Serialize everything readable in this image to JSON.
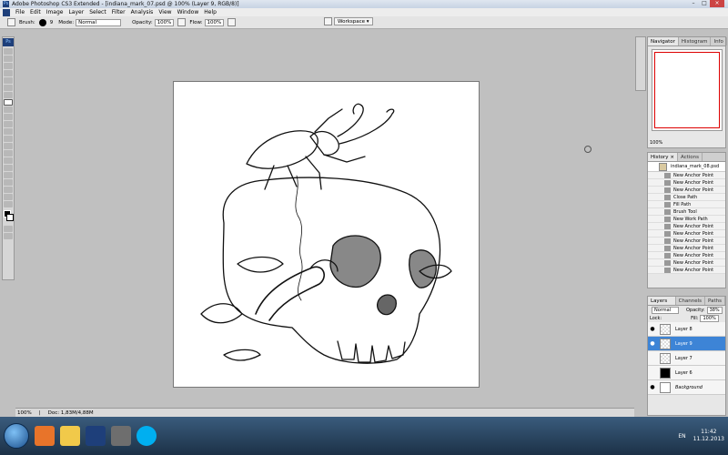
{
  "window": {
    "title": "Adobe Photoshop CS3 Extended - [indiana_mark_07.psd @ 100% (Layer 9, RGB/8)]",
    "controls": [
      "–",
      "□",
      "×"
    ]
  },
  "menu": [
    "File",
    "Edit",
    "Image",
    "Layer",
    "Select",
    "Filter",
    "Analysis",
    "View",
    "Window",
    "Help"
  ],
  "options": {
    "brush_label": "Brush:",
    "brush_size": "9",
    "mode_label": "Mode:",
    "mode_value": "Normal",
    "opacity_label": "Opacity:",
    "opacity_value": "100%",
    "flow_label": "Flow:",
    "flow_value": "100%",
    "workspace_label": "Workspace ▾"
  },
  "status": {
    "zoom": "100%",
    "doc": "Doc: 1,83M/4,88M"
  },
  "navigator": {
    "tabs": [
      "Navigator ×",
      "Histogram",
      "Info"
    ],
    "zoom": "100%"
  },
  "history": {
    "tabs": [
      "History ×",
      "Actions"
    ],
    "snapshot": "indiana_mark_08.psd",
    "items": [
      "New Anchor Point",
      "New Anchor Point",
      "New Anchor Point",
      "Close Path",
      "Fill Path",
      "Brush Tool",
      "New Work Path",
      "New Anchor Point",
      "New Anchor Point",
      "New Anchor Point",
      "New Anchor Point",
      "New Anchor Point",
      "New Anchor Point",
      "New Anchor Point"
    ]
  },
  "layers": {
    "tabs": [
      "Layers ×",
      "Channels",
      "Paths"
    ],
    "blend_mode": "Normal",
    "opacity_label": "Opacity:",
    "opacity_value": "38%",
    "lock_label": "Lock:",
    "fill_label": "Fill:",
    "fill_value": "100%",
    "rows": [
      {
        "name": "Layer 8"
      },
      {
        "name": "Layer 9"
      },
      {
        "name": "Layer 7"
      },
      {
        "name": "Layer 6"
      },
      {
        "name": "Background"
      }
    ]
  },
  "tray": {
    "lang": "EN",
    "time": "11:42",
    "date": "11.12.2013"
  },
  "colors": {
    "accent_selection": "#3d84d6",
    "photoshop_blue": "#1e3f7a"
  }
}
